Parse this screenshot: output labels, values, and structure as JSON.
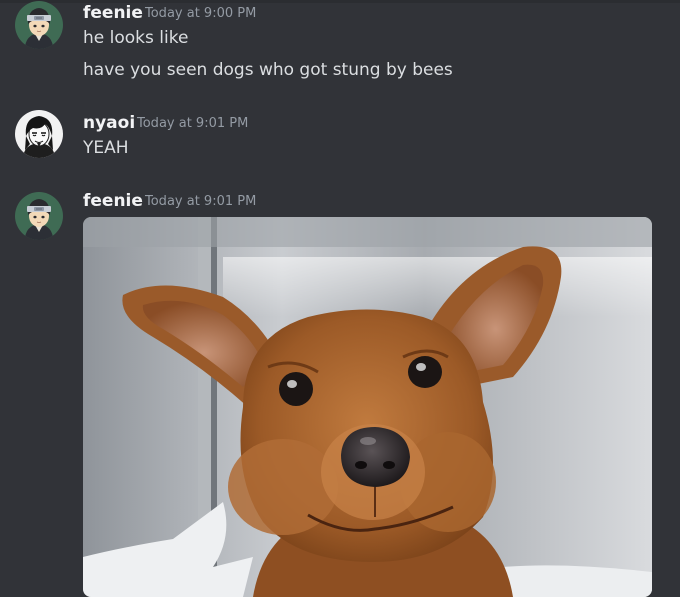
{
  "messages": [
    {
      "author": "feenie",
      "timestamp": "Today at 9:00 PM",
      "avatar_icon": "ninja-headband-avatar-icon",
      "lines": [
        "he looks like",
        "have you seen dogs who got stung by bees"
      ]
    },
    {
      "author": "nyaoi",
      "timestamp": "Today at 9:01 PM",
      "avatar_icon": "manga-character-avatar-icon",
      "lines": [
        "YEAH"
      ]
    },
    {
      "author": "feenie",
      "timestamp": "Today at 9:01 PM",
      "avatar_icon": "ninja-headband-avatar-icon",
      "attachment": {
        "type": "image",
        "description_icon": "swollen-face-dog-photo"
      }
    }
  ],
  "theme": {
    "background": "#313338",
    "username_color": "#f2f3f5",
    "text_color": "#dbdee1",
    "timestamp_color": "#949ba4"
  }
}
